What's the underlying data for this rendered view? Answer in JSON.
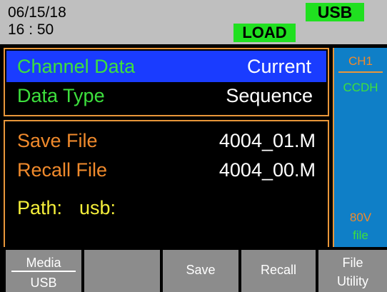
{
  "status": {
    "date": "06/15/18",
    "time": "16 : 50",
    "usb_badge": "USB",
    "load_badge": "LOAD"
  },
  "settings": {
    "channel_data_label": "Channel Data",
    "channel_data_value": "Current",
    "data_type_label": "Data Type",
    "data_type_value": "Sequence"
  },
  "files": {
    "save_file_label": "Save File",
    "save_file_value": "4004_01.M",
    "recall_file_label": "Recall File",
    "recall_file_value": "4004_00.M",
    "path_label": "Path:",
    "path_value": "usb:"
  },
  "channel_panel": {
    "channel": "CH1",
    "mode": "CCDH",
    "voltage": "80V",
    "source": "file"
  },
  "softkeys": {
    "media_top": "Media",
    "media_bottom": "USB",
    "save": "Save",
    "recall": "Recall",
    "file_utility_top": "File",
    "file_utility_bottom": "Utility"
  },
  "colors": {
    "status_bg": "#bfbfbf",
    "badge_green": "#20e020",
    "selection_blue": "#1a3cff",
    "label_green": "#3de03d",
    "label_orange": "#f08a2c",
    "label_yellow": "#f5ef3a",
    "channel_column_bg": "#0f7fc7",
    "softkey_gray": "#8c8c8c"
  }
}
